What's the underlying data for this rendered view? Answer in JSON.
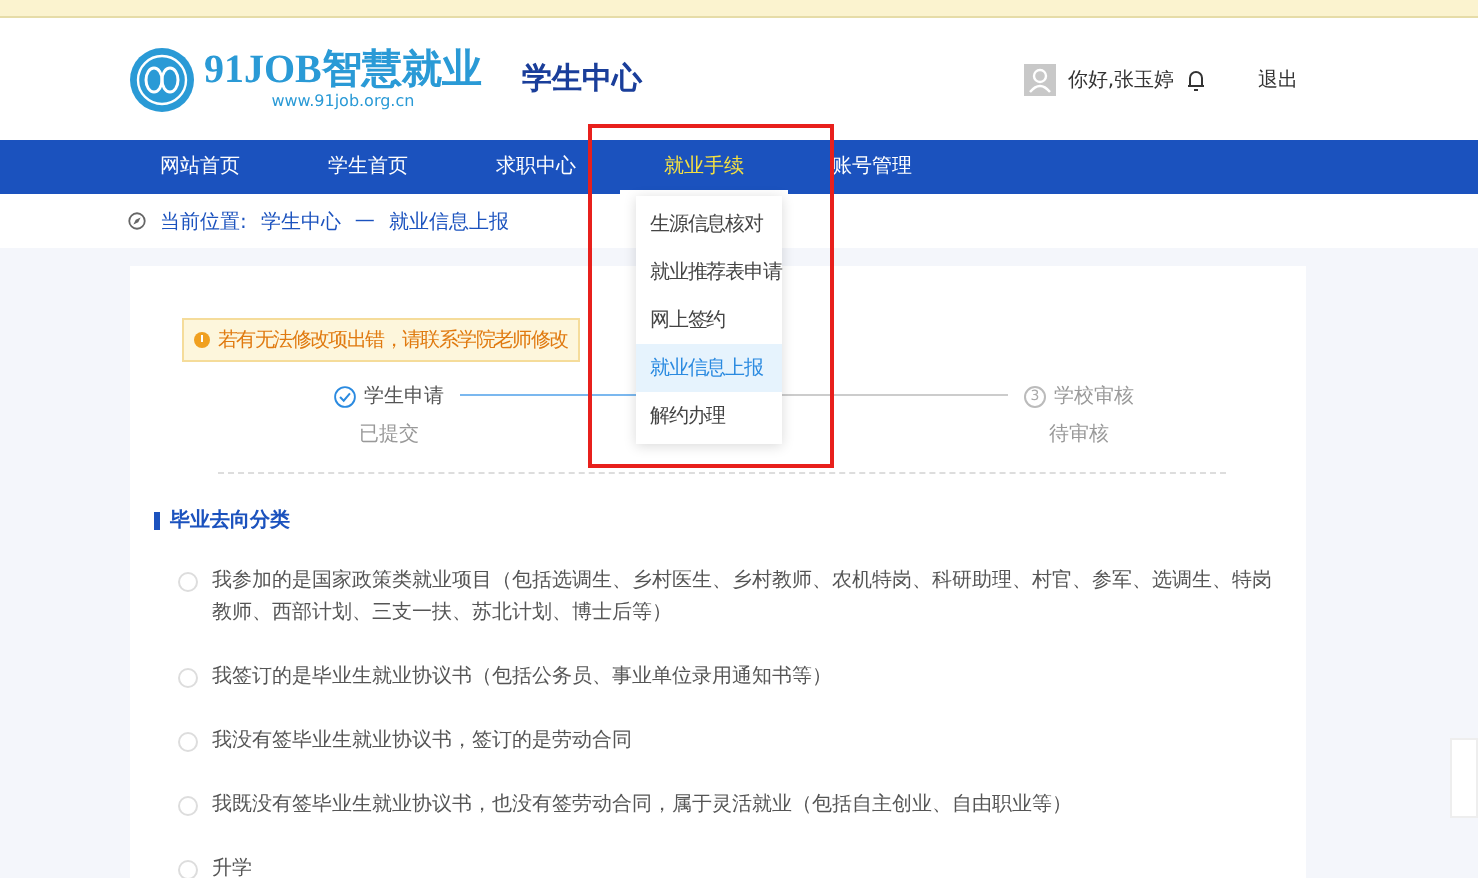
{
  "header": {
    "logo_title": "91JOB智慧就业",
    "logo_url": "www.91job.org.cn",
    "site_section": "学生中心",
    "greeting": "你好,张玉婷",
    "logout": "退出"
  },
  "nav": [
    {
      "label": "网站首页",
      "selected": false
    },
    {
      "label": "学生首页",
      "selected": false
    },
    {
      "label": "求职中心",
      "selected": false
    },
    {
      "label": "就业手续",
      "selected": true
    },
    {
      "label": "账号管理",
      "selected": false
    }
  ],
  "dropdown": [
    {
      "label": "生源信息核对",
      "selected": false
    },
    {
      "label": "就业推荐表申请",
      "selected": false
    },
    {
      "label": "网上签约",
      "selected": false
    },
    {
      "label": "就业信息上报",
      "selected": true
    },
    {
      "label": "解约办理",
      "selected": false
    }
  ],
  "breadcrumb": {
    "prefix": "当前位置:",
    "items": [
      "学生中心",
      "—",
      "就业信息上报"
    ]
  },
  "notice": "若有无法修改项出错，请联系学院老师修改",
  "steps": [
    {
      "title": "学生申请",
      "status": "已提交",
      "done": true
    },
    {
      "title": "学校审核",
      "status": "待审核",
      "done": false,
      "number": "3"
    }
  ],
  "section_title": "毕业去向分类",
  "options": [
    {
      "label": "我参加的是国家政策类就业项目（包括选调生、乡村医生、乡村教师、农机特岗、科研助理、村官、参军、选调生、特岗教师、西部计划、三支一扶、苏北计划、博士后等）",
      "selected": false
    },
    {
      "label": "我签订的是毕业生就业协议书（包括公务员、事业单位录用通知书等）",
      "selected": false
    },
    {
      "label": "我没有签毕业生就业协议书，签订的是劳动合同",
      "selected": false
    },
    {
      "label": "我既没有签毕业生就业协议书，也没有签劳动合同，属于灵活就业（包括自主创业、自由职业等）",
      "selected": false
    },
    {
      "label": "升学",
      "selected": false
    }
  ]
}
